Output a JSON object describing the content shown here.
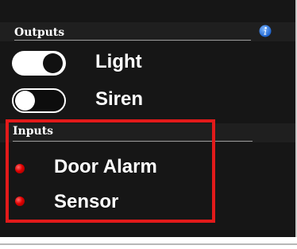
{
  "outputs": {
    "title": "Outputs",
    "info_icon": "info-icon",
    "items": [
      {
        "label": "Light",
        "state": "on"
      },
      {
        "label": "Siren",
        "state": "off"
      }
    ]
  },
  "inputs": {
    "title": "Inputs",
    "items": [
      {
        "label": "Door Alarm",
        "status_color": "#e00000"
      },
      {
        "label": "Sensor",
        "status_color": "#e00000"
      }
    ]
  },
  "highlight_color": "#e21a1a"
}
